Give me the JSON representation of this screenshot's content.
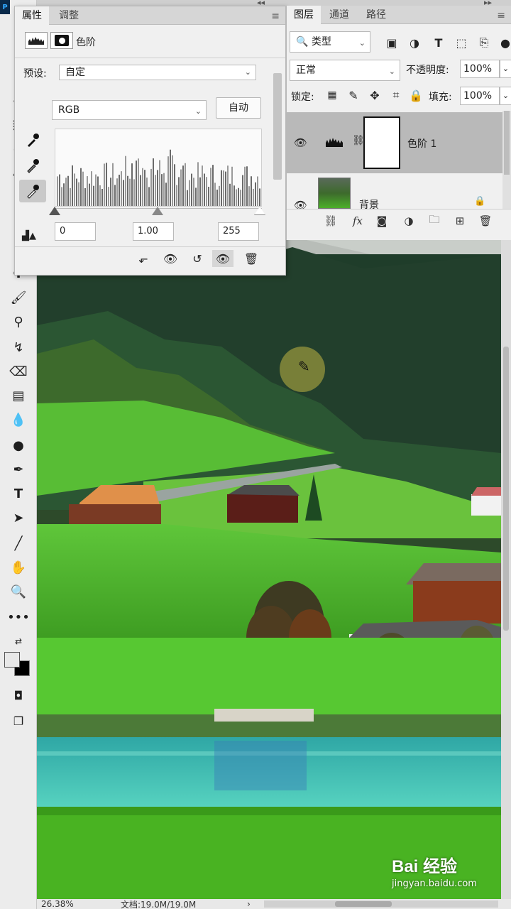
{
  "properties_panel": {
    "tabs": [
      "属性",
      "调整"
    ],
    "adjustment_name": "色阶",
    "preset_label": "预设:",
    "preset_value": "自定",
    "channel_value": "RGB",
    "auto_button": "自动",
    "input_black": "0",
    "input_gamma": "1.00",
    "input_white": "255"
  },
  "layers_panel": {
    "tabs": [
      "图层",
      "通道",
      "路径"
    ],
    "filter_kind": "类型",
    "blend_mode": "正常",
    "opacity_label": "不透明度:",
    "opacity_value": "100%",
    "lock_label": "锁定:",
    "fill_label": "填充:",
    "fill_value": "100%",
    "layers": [
      {
        "name": "色阶 1",
        "selected": true
      },
      {
        "name": "背景",
        "selected": false
      }
    ]
  },
  "status_bar": {
    "zoom": "26.38%",
    "doc_info": "文档:19.0M/19.0M"
  },
  "watermark": {
    "logo": "Bai 经验",
    "url": "jingyan.baidu.com"
  },
  "colors": {
    "panel_bg": "#f0f0f0",
    "selected_layer": "#b9b9b9",
    "canvas_grass": "#4caf2a",
    "lake": "#3fb8b0"
  }
}
